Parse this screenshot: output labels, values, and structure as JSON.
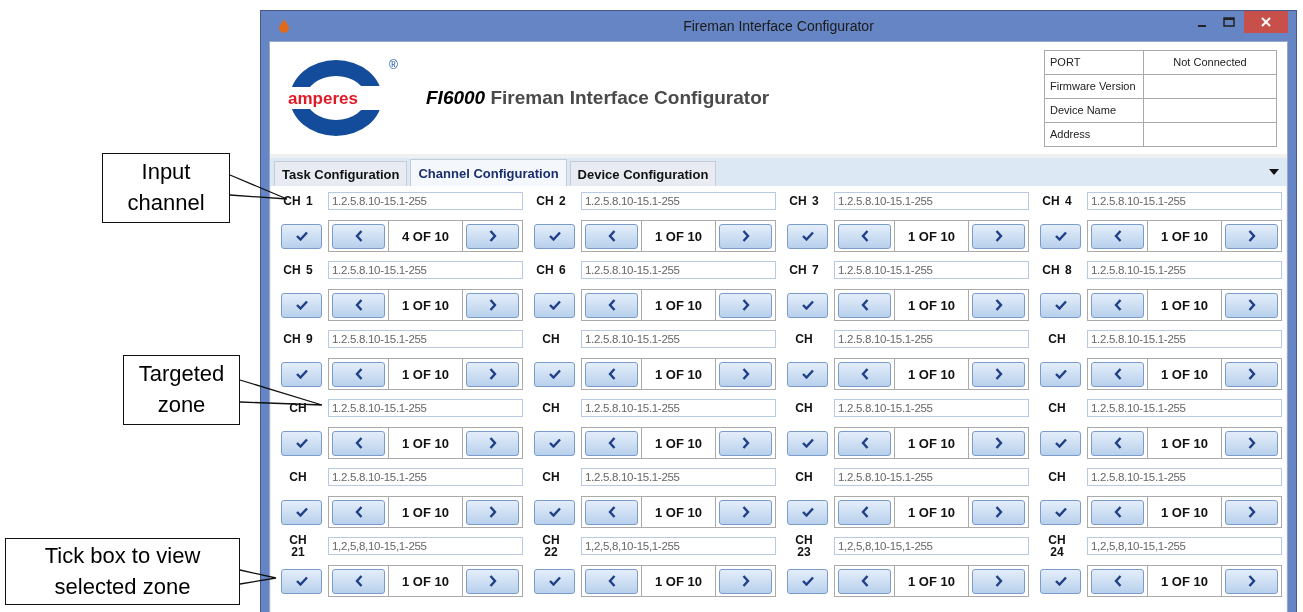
{
  "callouts": [
    {
      "text": "Input channel"
    },
    {
      "text": "Targeted zone"
    },
    {
      "text": "Tick box to view selected zone"
    }
  ],
  "window": {
    "title": "Fireman Interface Configurator"
  },
  "logo": {
    "name": "amperes",
    "mark": "®"
  },
  "header_title": "*FI6000* Fireman Interface Configurator",
  "info": [
    {
      "label": "PORT",
      "value": "Not Connected"
    },
    {
      "label": "Firmware Version"
    },
    {
      "label": "Device Name"
    },
    {
      "label": "Address"
    }
  ],
  "tabs": [
    {
      "label": "Task Configuration",
      "selected": false
    },
    {
      "label": "Channel Configuration",
      "selected": true
    },
    {
      "label": "Device Configuration",
      "selected": false
    }
  ],
  "channels": [
    {
      "label": "CH 1",
      "zone": "1.2.5.8.10-15.1-255",
      "page": "4 OF 10"
    },
    {
      "label": "CH 2",
      "zone": "1.2.5.8.10-15.1-255",
      "page": "1 OF 10"
    },
    {
      "label": "CH 3",
      "zone": "1.2.5.8.10-15.1-255",
      "page": "1 OF 10"
    },
    {
      "label": "CH 4",
      "zone": "1.2.5.8.10-15.1-255",
      "page": "1 OF 10"
    },
    {
      "label": "CH 5",
      "zone": "1.2.5.8.10-15.1-255",
      "page": "1 OF 10"
    },
    {
      "label": "CH 6",
      "zone": "1.2.5.8.10-15.1-255",
      "page": "1 OF 10"
    },
    {
      "label": "CH 7",
      "zone": "1.2.5.8.10-15.1-255",
      "page": "1 OF 10"
    },
    {
      "label": "CH 8",
      "zone": "1.2.5.8.10-15.1-255",
      "page": "1 OF 10"
    },
    {
      "label": "CH 9",
      "zone": "1.2.5.8.10-15.1-255",
      "page": "1 OF 10"
    },
    {
      "label": "CH",
      "zone": "1.2.5.8.10-15.1-255",
      "page": "1 OF 10"
    },
    {
      "label": "CH",
      "zone": "1.2.5.8.10-15.1-255",
      "page": "1 OF 10"
    },
    {
      "label": "CH",
      "zone": "1.2.5.8.10-15.1-255",
      "page": "1 OF 10"
    },
    {
      "label": "CH",
      "zone": "1.2.5.8.10-15.1-255",
      "page": "1 OF 10"
    },
    {
      "label": "CH",
      "zone": "1.2.5.8.10-15.1-255",
      "page": "1 OF 10"
    },
    {
      "label": "CH",
      "zone": "1.2.5.8.10-15.1-255",
      "page": "1 OF 10"
    },
    {
      "label": "CH",
      "zone": "1.2.5.8.10-15.1-255",
      "page": "1 OF 10"
    },
    {
      "label": "CH",
      "zone": "1.2.5.8.10-15.1-255",
      "page": "1 OF 10"
    },
    {
      "label": "CH",
      "zone": "1.2.5.8.10-15.1-255",
      "page": "1 OF 10"
    },
    {
      "label": "CH",
      "zone": "1.2.5.8.10-15.1-255",
      "page": "1 OF 10"
    },
    {
      "label": "CH",
      "zone": "1.2.5.8.10-15.1-255",
      "page": "1 OF 10"
    },
    {
      "label": "CH 21",
      "zone": "1,2,5,8,10-15,1-255",
      "page": "1 OF 10"
    },
    {
      "label": "CH 22",
      "zone": "1,2,5,8,10-15,1-255",
      "page": "1 OF 10"
    },
    {
      "label": "CH 23",
      "zone": "1,2,5,8,10-15,1-255",
      "page": "1 OF 10"
    },
    {
      "label": "CH 24",
      "zone": "1,2,5,8,10-15,1-255",
      "page": "1 OF 10"
    }
  ]
}
